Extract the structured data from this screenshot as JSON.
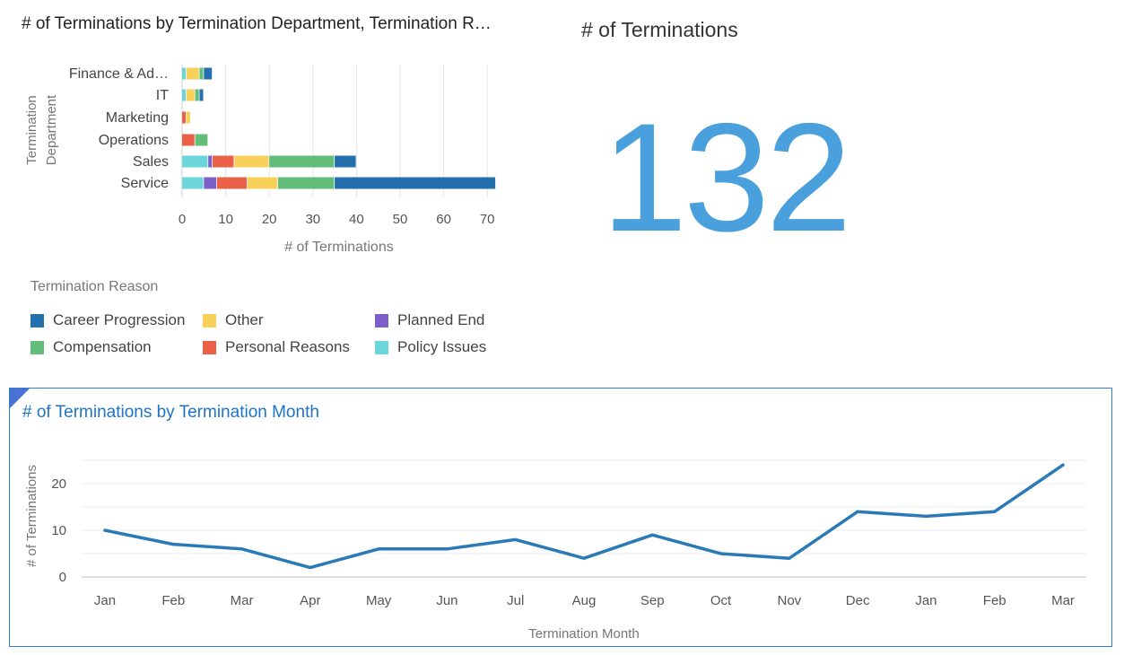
{
  "bar_chart": {
    "title": "# of Terminations by Termination Department, Termination R…"
  },
  "kpi": {
    "title": "# of Terminations",
    "value": "132"
  },
  "legend": {
    "title": "Termination Reason",
    "items": [
      {
        "label": "Career Progression",
        "color": "#2470ad"
      },
      {
        "label": "Other",
        "color": "#f7d15a"
      },
      {
        "label": "Planned End",
        "color": "#7d5fc9"
      },
      {
        "label": "Compensation",
        "color": "#62bd79"
      },
      {
        "label": "Personal Reasons",
        "color": "#ea6148"
      },
      {
        "label": "Policy Issues",
        "color": "#6ad6dc"
      }
    ]
  },
  "line_chart": {
    "title": "# of Terminations by Termination Month"
  },
  "chart_data": [
    {
      "type": "bar",
      "orientation": "horizontal",
      "stacked": true,
      "title": "# of Terminations by Termination Department, Termination R…",
      "xlabel": "# of Terminations",
      "ylabel": "Termination Department",
      "xlim": [
        0,
        72
      ],
      "xticks": [
        0,
        10,
        20,
        30,
        40,
        50,
        60,
        70
      ],
      "categories": [
        "Finance & Ad…",
        "IT",
        "Marketing",
        "Operations",
        "Sales",
        "Service"
      ],
      "series": [
        {
          "name": "Policy Issues",
          "color": "#6ad6dc",
          "values": [
            1,
            1,
            0,
            0,
            6,
            5
          ]
        },
        {
          "name": "Planned End",
          "color": "#7d5fc9",
          "values": [
            0,
            0,
            0,
            0,
            1,
            3
          ]
        },
        {
          "name": "Personal Reasons",
          "color": "#ea6148",
          "values": [
            0,
            0,
            1,
            3,
            5,
            7
          ]
        },
        {
          "name": "Other",
          "color": "#f7d15a",
          "values": [
            3,
            2,
            1,
            0,
            8,
            7
          ]
        },
        {
          "name": "Compensation",
          "color": "#62bd79",
          "values": [
            1,
            1,
            0,
            3,
            15,
            13
          ]
        },
        {
          "name": "Career Progression",
          "color": "#2470ad",
          "values": [
            2,
            1,
            0,
            0,
            5,
            37
          ]
        }
      ],
      "legend_title": "Termination Reason",
      "legend_position": "bottom",
      "grid": true
    },
    {
      "type": "line",
      "title": "# of Terminations by Termination Month",
      "xlabel": "Termination Month",
      "ylabel": "# of Terminations",
      "ylim": [
        0,
        25
      ],
      "yticks": [
        0,
        10,
        20
      ],
      "categories": [
        "Jan",
        "Feb",
        "Mar",
        "Apr",
        "May",
        "Jun",
        "Jul",
        "Aug",
        "Sep",
        "Oct",
        "Nov",
        "Dec",
        "Jan",
        "Feb",
        "Mar"
      ],
      "series": [
        {
          "name": "# of Terminations",
          "color": "#2a7ab6",
          "values": [
            10,
            7,
            6,
            2,
            6,
            6,
            8,
            4,
            9,
            5,
            4,
            14,
            13,
            14,
            24
          ]
        }
      ],
      "grid": true
    }
  ]
}
